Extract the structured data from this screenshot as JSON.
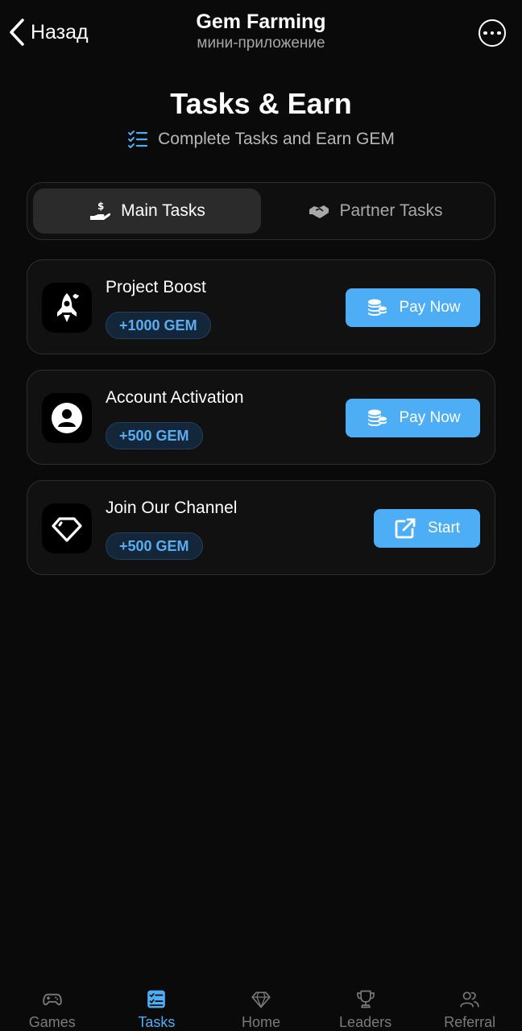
{
  "header": {
    "back_label": "Назад",
    "title": "Gem Farming",
    "subtitle": "мини-приложение"
  },
  "page": {
    "title": "Tasks & Earn",
    "subtitle": "Complete Tasks and Earn GEM"
  },
  "tabs": [
    {
      "label": "Main Tasks",
      "icon": "hand-coin-icon",
      "active": true
    },
    {
      "label": "Partner Tasks",
      "icon": "handshake-icon",
      "active": false
    }
  ],
  "tasks": [
    {
      "title": "Project Boost",
      "reward": "+1000 GEM",
      "icon": "rocket-icon",
      "action": "Pay Now"
    },
    {
      "title": "Account Activation",
      "reward": "+500 GEM",
      "icon": "user-icon",
      "action": "Pay Now"
    },
    {
      "title": "Join Our Channel",
      "reward": "+500 GEM",
      "icon": "diamond-icon",
      "action": "Start"
    }
  ],
  "nav": [
    {
      "label": "Games",
      "icon": "gamepad-icon",
      "active": false
    },
    {
      "label": "Tasks",
      "icon": "checklist-icon",
      "active": true
    },
    {
      "label": "Home",
      "icon": "diamond-icon",
      "active": false
    },
    {
      "label": "Leaders",
      "icon": "trophy-icon",
      "active": false
    },
    {
      "label": "Referral",
      "icon": "users-icon",
      "active": false
    }
  ],
  "colors": {
    "background": "#0a0a0a",
    "accent": "#4eaef5",
    "card": "#111111",
    "reward_text": "#5aaef0"
  }
}
